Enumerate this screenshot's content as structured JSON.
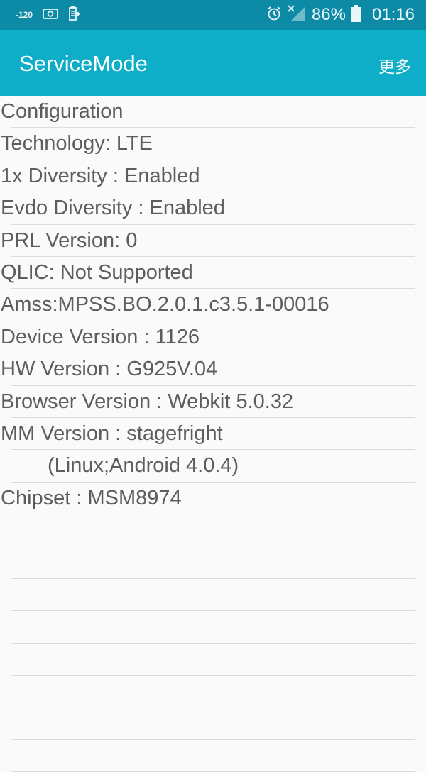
{
  "status_bar": {
    "signal_strength": "-120",
    "battery_percent": "86%",
    "time": "01:16",
    "icons": [
      "screenshot-icon",
      "battery-saver-icon",
      "alarm-icon",
      "no-signal-icon",
      "battery-icon"
    ]
  },
  "app_bar": {
    "title": "ServiceMode",
    "more_label": "更多"
  },
  "rows": [
    "Configuration",
    "Technology: LTE",
    "1x Diversity : Enabled",
    "Evdo Diversity : Enabled",
    "PRL Version: 0",
    "QLIC: Not Supported",
    "Amss:MPSS.BO.2.0.1.c3.5.1-00016",
    "Device Version : 1126",
    "HW Version : G925V.04",
    "Browser Version : Webkit 5.0.32",
    "MM Version : stagefright",
    "(Linux;Android 4.0.4)",
    "Chipset : MSM8974",
    "",
    "",
    "",
    "",
    "",
    "",
    "",
    ""
  ],
  "colors": {
    "status_bar_bg": "#0d8aa6",
    "app_bar_bg": "#0eaec9",
    "list_bg": "#fafafa",
    "text": "#5d5d5d",
    "divider": "#dcdcdc"
  }
}
